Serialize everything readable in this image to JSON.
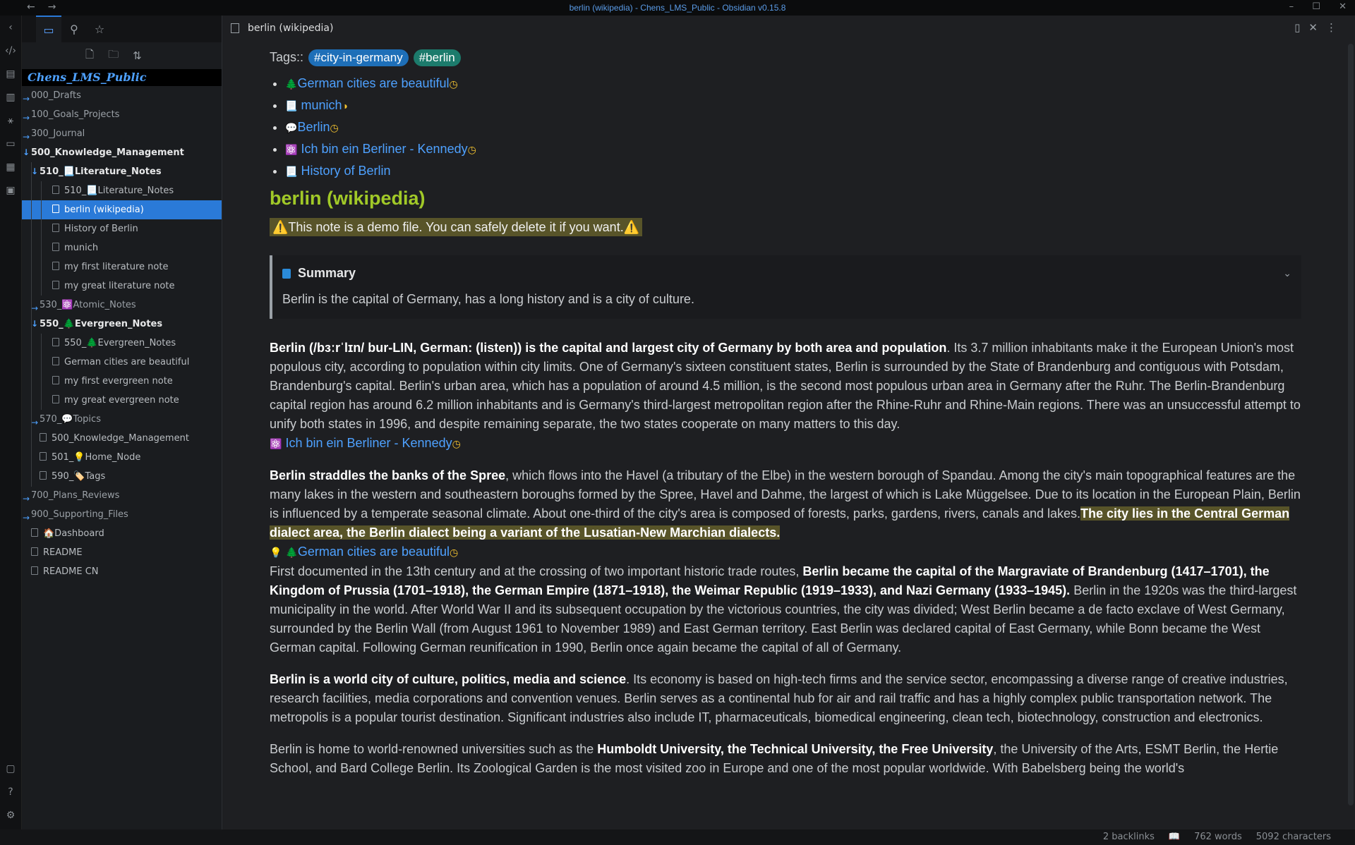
{
  "window": {
    "title": "berlin (wikipedia) - Chens_LMS_Public - Obsidian v0.15.8"
  },
  "sidebar": {
    "vault_name": "Chens_LMS_Public",
    "tree": [
      {
        "label": "000_Drafts",
        "type": "folder",
        "depth": 0,
        "style": "collapsed"
      },
      {
        "label": "100_Goals_Projects",
        "type": "folder",
        "depth": 0,
        "style": "collapsed"
      },
      {
        "label": "300_Journal",
        "type": "folder",
        "depth": 0,
        "style": "collapsed"
      },
      {
        "label": "500_Knowledge_Management",
        "type": "folder",
        "depth": 0,
        "style": "expanded"
      },
      {
        "label": "510_📃Literature_Notes",
        "type": "folder",
        "depth": 1,
        "style": "expanded"
      },
      {
        "label": "510_📃Literature_Notes",
        "type": "file",
        "depth": 2
      },
      {
        "label": "berlin (wikipedia)",
        "type": "file",
        "depth": 2,
        "selected": true
      },
      {
        "label": "History of Berlin",
        "type": "file",
        "depth": 2
      },
      {
        "label": "munich",
        "type": "file",
        "depth": 2
      },
      {
        "label": "my first literature note",
        "type": "file",
        "depth": 2
      },
      {
        "label": "my great literature note",
        "type": "file",
        "depth": 2
      },
      {
        "label": "530_⚛️Atomic_Notes",
        "type": "folder",
        "depth": 1,
        "style": "collapsed"
      },
      {
        "label": "550_🌲Evergreen_Notes",
        "type": "folder",
        "depth": 1,
        "style": "expanded"
      },
      {
        "label": "550_🌲Evergreen_Notes",
        "type": "file",
        "depth": 2
      },
      {
        "label": "German cities are beautiful",
        "type": "file",
        "depth": 2
      },
      {
        "label": "my first evergreen note",
        "type": "file",
        "depth": 2
      },
      {
        "label": "my great evergreen note",
        "type": "file",
        "depth": 2
      },
      {
        "label": "570_💬Topics",
        "type": "folder",
        "depth": 1,
        "style": "collapsed"
      },
      {
        "label": "500_Knowledge_Management",
        "type": "file",
        "depth": 1
      },
      {
        "label": "501_💡Home_Node",
        "type": "file",
        "depth": 1
      },
      {
        "label": "590_🏷️Tags",
        "type": "file",
        "depth": 1
      },
      {
        "label": "700_Plans_Reviews",
        "type": "folder",
        "depth": 0,
        "style": "collapsed"
      },
      {
        "label": "900_Supporting_Files",
        "type": "folder",
        "depth": 0,
        "style": "collapsed"
      },
      {
        "label": "🏠Dashboard",
        "type": "file",
        "depth": 0
      },
      {
        "label": "README",
        "type": "file",
        "depth": 0
      },
      {
        "label": "README CN",
        "type": "file",
        "depth": 0
      }
    ]
  },
  "tab": {
    "title": "berlin (wikipedia)"
  },
  "note": {
    "tags_label": "Tags::",
    "tags": [
      "#city-in-germany",
      "#berlin"
    ],
    "links": [
      {
        "icon": "🌲",
        "text": "German cities are beautiful",
        "marker": "◷"
      },
      {
        "icon": "📃",
        "text": "munich",
        "marker": "◑"
      },
      {
        "icon": "💬",
        "text": "Berlin",
        "marker": "◷"
      },
      {
        "icon": "⚛️",
        "text": "Ich bin ein Berliner - Kennedy",
        "marker": "◷"
      },
      {
        "icon": "📃",
        "text": "History of Berlin",
        "marker": ""
      }
    ],
    "heading": "berlin (wikipedia)",
    "demo_notice": "⚠️This note is a demo file. You can safely delete it if you want.⚠️",
    "callout": {
      "title": "Summary",
      "body": "Berlin is the capital of Germany, has a long history and is a city of culture."
    },
    "p1_bold": "Berlin (/bɜːrˈlɪn/ bur-LIN, German: (listen)) is the capital and largest city of Germany by both area and population",
    "p1_rest": ". Its 3.7 million inhabitants make it the European Union's most populous city, according to population within city limits. One of Germany's sixteen constituent states, Berlin is surrounded by the State of Brandenburg and contiguous with Potsdam, Brandenburg's capital. Berlin's urban area, which has a population of around 4.5 million, is the second most populous urban area in Germany after the Ruhr. The Berlin-Brandenburg capital region has around 6.2 million inhabitants and is Germany's third-largest metropolitan region after the Rhine-Ruhr and Rhine-Main regions. There was an unsuccessful attempt to unify both states in 1996, and despite remaining separate, the two states cooperate on many matters to this day.",
    "p1_link_icon": "⚛️",
    "p1_link": "Ich bin ein Berliner - Kennedy",
    "p1_link_marker": "◷",
    "p2_bold": "Berlin straddles the banks of the Spree",
    "p2_rest": ", which flows into the Havel (a tributary of the Elbe) in the western borough of Spandau. Among the city's main topographical features are the many lakes in the western and southeastern boroughs formed by the Spree, Havel and Dahme, the largest of which is Lake Müggelsee. Due to its location in the European Plain, Berlin is influenced by a temperate seasonal climate. About one-third of the city's area is composed of forests, parks, gardens, rivers, canals and lakes.",
    "p2_highlight": "The city lies in the Central German dialect area, the Berlin dialect being a variant of the Lusatian-New Marchian dialects.",
    "p2_link_prefix": "💡",
    "p2_link_icon": "🌲",
    "p2_link": "German cities are beautiful",
    "p2_link_marker": "◷",
    "p3_start": "First documented in the 13th century and at the crossing of two important historic trade routes, ",
    "p3_bold": "Berlin became the capital of the Margraviate of Brandenburg (1417–1701), the Kingdom of Prussia (1701–1918), the German Empire (1871–1918), the Weimar Republic (1919–1933), and Nazi Germany (1933–1945).",
    "p3_rest": " Berlin in the 1920s was the third-largest municipality in the world. After World War II and its subsequent occupation by the victorious countries, the city was divided; West Berlin became a de facto exclave of West Germany, surrounded by the Berlin Wall (from August 1961 to November 1989) and East German territory. East Berlin was declared capital of East Germany, while Bonn became the West German capital. Following German reunification in 1990, Berlin once again became the capital of all of Germany.",
    "p4_bold": "Berlin is a world city of culture, politics, media and science",
    "p4_rest": ". Its economy is based on high-tech firms and the service sector, encompassing a diverse range of creative industries, research facilities, media corporations and convention venues. Berlin serves as a continental hub for air and rail traffic and has a highly complex public transportation network. The metropolis is a popular tourist destination. Significant industries also include IT, pharmaceuticals, biomedical engineering, clean tech, biotechnology, construction and electronics.",
    "p5_start": "Berlin is home to world-renowned universities such as the ",
    "p5_bold": "Humboldt University, the Technical University, the Free University",
    "p5_rest": ", the University of the Arts, ESMT Berlin, the Hertie School, and Bard College Berlin. Its Zoological Garden is the most visited zoo in Europe and one of the most popular worldwide. With Babelsberg being the world's"
  },
  "status": {
    "backlinks": "2 backlinks",
    "words": "762 words",
    "characters": "5092 characters"
  },
  "colors": {
    "accent": "#2a7ad8",
    "link": "#4ea1ff",
    "heading": "#a1c928",
    "highlight": "#585429"
  }
}
